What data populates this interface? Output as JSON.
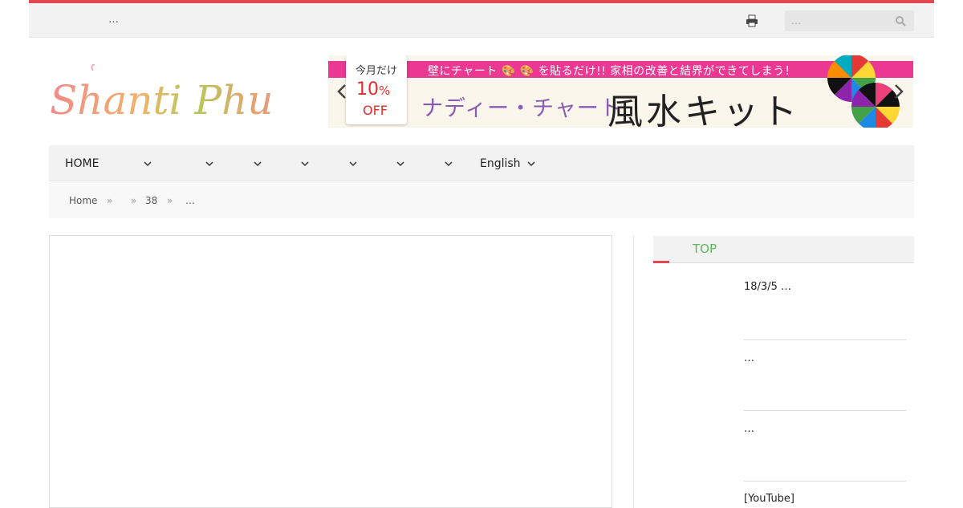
{
  "topbar": {
    "menu_text": "…",
    "search_placeholder": "…"
  },
  "logo": {
    "text": "Shanti Phula"
  },
  "banner": {
    "tag_line1": "今月だけ",
    "tag_percent": "10",
    "tag_percent_sign": "%",
    "tag_off": "OFF",
    "pink_text": "壁にチャート 🎨 🎨 を貼るだけ!! 家相の改善と結界ができてしまう！",
    "subtitle": "ナディー・チャート",
    "title": "風水キット"
  },
  "nav": {
    "items": [
      {
        "label": "HOME"
      },
      {
        "label": ""
      },
      {
        "label": ""
      },
      {
        "label": ""
      },
      {
        "label": ""
      },
      {
        "label": ""
      },
      {
        "label": ""
      },
      {
        "label": ""
      },
      {
        "label": "English"
      }
    ]
  },
  "breadcrumb": {
    "home": "Home",
    "sep": "»",
    "level2": "",
    "level3": "38",
    "current": "…"
  },
  "sidebar": {
    "heading": "TOP",
    "posts": [
      {
        "title": "18/3/5 …"
      },
      {
        "title": "…"
      },
      {
        "title": "…"
      },
      {
        "title": "[YouTube]"
      }
    ]
  },
  "colors": {
    "accent": "#e2474f",
    "sidebar_heading": "#5cb85c",
    "banner_pink": "#ea3893"
  }
}
